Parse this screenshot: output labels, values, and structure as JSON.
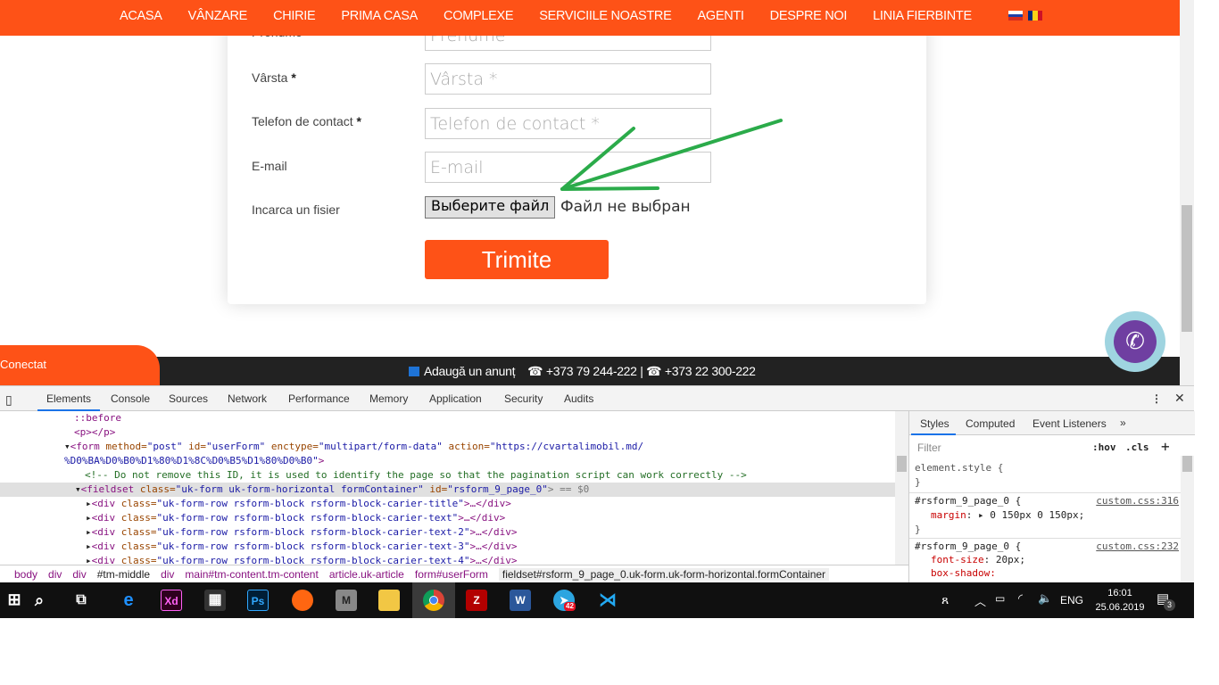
{
  "nav": {
    "items": [
      "ACASA",
      "VÂNZARE",
      "CHIRIE",
      "PRIMA CASA",
      "COMPLEXE",
      "SERVICIILE NOASTRE",
      "AGENTI",
      "DESPRE NOI",
      "LINIA FIERBINTE"
    ],
    "languages": [
      "ru",
      "ro"
    ]
  },
  "form": {
    "prenume_label": "Prenume",
    "prenume_placeholder": "Prenume",
    "varsta_label": "Vârsta",
    "varsta_placeholder": "Vârsta *",
    "telefon_label": "Telefon de contact",
    "telefon_placeholder": "Telefon de contact *",
    "email_label": "E-mail",
    "email_placeholder": "E-mail",
    "required_mark": "*",
    "file_label": "Incarca un fisier",
    "file_button": "Выберите файл",
    "file_status": "Файл не выбран",
    "submit": "Trimite"
  },
  "footer_bar": {
    "conectat": "Conectat",
    "add_ad": "Adaugă un anunț",
    "phones": "☎ +373 79 244-222 | ☎ +373 22 300-222"
  },
  "devtools": {
    "tabs": [
      "Elements",
      "Console",
      "Sources",
      "Network",
      "Performance",
      "Memory",
      "Application",
      "Security",
      "Audits"
    ],
    "active_tab": "Elements",
    "dom_lines": {
      "before": "::before",
      "p": "<p></p>",
      "form_tag": "<form",
      "form_method": "method=",
      "form_method_v": "\"post\"",
      "form_id": "id=",
      "form_id_v": "\"userForm\"",
      "form_enc": "enctype=",
      "form_enc_v": "\"multipart/form-data\"",
      "form_action": "action=",
      "form_action_v": "\"https://cvartalimobil.md/",
      "form_action_v2": "%D0%BA%D0%B0%D1%80%D1%8C%D0%B5%D1%80%D0%B0\"",
      "comment": "<!-- Do not remove this ID, it is used to identify the page so that the pagination script can work correctly -->",
      "fieldset": "<fieldset",
      "fieldset_class": "class=",
      "fieldset_class_v": "\"uk-form uk-form-horizontal formContainer\"",
      "fieldset_id": "id=",
      "fieldset_id_v": "\"rsform_9_page_0\"",
      "fieldset_tail": "> == $0",
      "divs": [
        "\"uk-form-row rsform-block rsform-block-carier-title\"",
        "\"uk-form-row rsform-block rsform-block-carier-text\"",
        "\"uk-form-row rsform-block rsform-block-carier-text-2\"",
        "\"uk-form-row rsform-block rsform-block-carier-text-3\"",
        "\"uk-form-row rsform-block rsform-block-carier-text-4\""
      ]
    },
    "breadcrumbs": [
      "body",
      "div",
      "div",
      "#tm-middle",
      "div",
      "main#tm-content.tm-content",
      "article.uk-article",
      "form#userForm",
      "fieldset#rsform_9_page_0.uk-form.uk-form-horizontal.formContainer"
    ],
    "styles_tabs": [
      "Styles",
      "Computed",
      "Event Listeners",
      "»"
    ],
    "filter_placeholder": "Filter",
    "hov": ":hov",
    "cls": ".cls",
    "plus": "+",
    "rules": [
      {
        "selector": "element.style {",
        "close": "}"
      },
      {
        "selector": "#rsform_9_page_0 {",
        "source": "custom.css:316",
        "prop": "margin",
        "value": "▸ 0 150px 0 150px;",
        "close": "}"
      },
      {
        "selector": "#rsform_9_page_0 {",
        "source": "custom.css:232",
        "prop": "font-size",
        "value": "20px;",
        "prop2": "box-shadow:"
      }
    ]
  },
  "taskbar": {
    "language": "ENG",
    "time": "16:01",
    "date": "25.06.2019",
    "notifications": "3",
    "telegram_badge": "42"
  },
  "colors": {
    "brand": "#fe5217",
    "annotation_arrow": "#2bab4a"
  }
}
